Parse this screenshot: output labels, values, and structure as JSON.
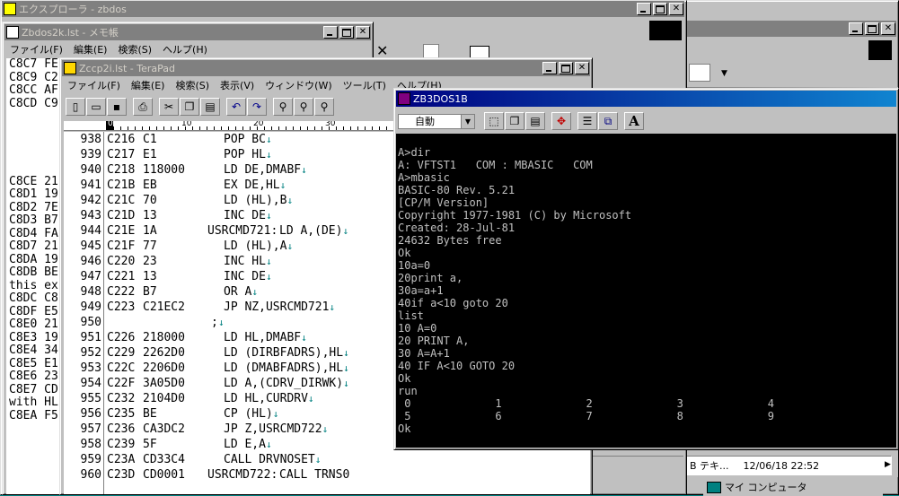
{
  "explorer": {
    "title": "エクスプローラ - zbdos"
  },
  "right_window": {
    "status_label": "B テキ...",
    "status_time": "12/06/18 22:52",
    "my_computer": "マイ コンピュータ"
  },
  "notepad": {
    "title": "Zbdos2k.lst - メモ帳",
    "menu": [
      "ファイル(F)",
      "編集(E)",
      "検索(S)",
      "ヘルプ(H)"
    ],
    "lines": [
      "C8C7 FE",
      "C8C9 C2",
      "C8CC AF",
      "C8CD C9",
      "",
      "",
      "",
      "",
      "",
      "C8CE 21",
      "C8D1 19",
      "C8D2 7E",
      "C8D3 B7",
      "C8D4 FA",
      "C8D7 21",
      "C8DA 19",
      "C8DB BE",
      "this ex",
      "C8DC C8",
      "C8DF E5",
      "C8E0 21",
      "C8E3 19",
      "C8E4 34",
      "C8E5 E1",
      "C8E6 23",
      "C8E7 CD",
      "with HL",
      "C8EA F5"
    ]
  },
  "terapad": {
    "title": "Zccp2i.lst - TeraPad",
    "menu": [
      "ファイル(F)",
      "編集(E)",
      "検索(S)",
      "表示(V)",
      "ウィンドウ(W)",
      "ツール(T)",
      "ヘルプ(H)"
    ],
    "ruler": {
      "marks": [
        "0",
        "10",
        "20",
        "30"
      ]
    },
    "lines": [
      {
        "num": "938",
        "addr": "C216",
        "hex": "C1",
        "label": "",
        "code": "POP BC",
        "lf": true
      },
      {
        "num": "939",
        "addr": "C217",
        "hex": "E1",
        "label": "",
        "code": "POP HL",
        "lf": true
      },
      {
        "num": "940",
        "addr": "C218",
        "hex": "118000",
        "label": "",
        "code": "LD DE,DMABF",
        "lf": true
      },
      {
        "num": "941",
        "addr": "C21B",
        "hex": "EB",
        "label": "",
        "code": "EX DE,HL",
        "lf": true
      },
      {
        "num": "942",
        "addr": "C21C",
        "hex": "70",
        "label": "",
        "code": "LD (HL),B",
        "lf": true
      },
      {
        "num": "943",
        "addr": "C21D",
        "hex": "13",
        "label": "",
        "code": "INC DE",
        "lf": true
      },
      {
        "num": "944",
        "addr": "C21E",
        "hex": "1A",
        "label": "USRCMD721:",
        "code": "LD A,(DE)",
        "lf": true
      },
      {
        "num": "945",
        "addr": "C21F",
        "hex": "77",
        "label": "",
        "code": "LD (HL),A",
        "lf": true
      },
      {
        "num": "946",
        "addr": "C220",
        "hex": "23",
        "label": "",
        "code": "INC HL",
        "lf": true
      },
      {
        "num": "947",
        "addr": "C221",
        "hex": "13",
        "label": "",
        "code": "INC DE",
        "lf": true
      },
      {
        "num": "948",
        "addr": "C222",
        "hex": "B7",
        "label": "",
        "code": "OR A",
        "lf": true
      },
      {
        "num": "949",
        "addr": "C223",
        "hex": "C21EC2",
        "label": "",
        "code": "JP NZ,USRCMD721",
        "lf": true
      },
      {
        "num": "950",
        "addr": "",
        "hex": "",
        "label": ";",
        "code": "",
        "lf": true
      },
      {
        "num": "951",
        "addr": "C226",
        "hex": "218000",
        "label": "",
        "code": "LD HL,DMABF",
        "lf": true
      },
      {
        "num": "952",
        "addr": "C229",
        "hex": "2262D0",
        "label": "",
        "code": "LD (DIRBFADRS),HL",
        "lf": true
      },
      {
        "num": "953",
        "addr": "C22C",
        "hex": "2206D0",
        "label": "",
        "code": "LD (DMABFADRS),HL",
        "lf": true
      },
      {
        "num": "954",
        "addr": "C22F",
        "hex": "3A05D0",
        "label": "",
        "code": "LD A,(CDRV_DIRWK)",
        "lf": true
      },
      {
        "num": "955",
        "addr": "C232",
        "hex": "2104D0",
        "label": "",
        "code": "LD HL,CURDRV",
        "lf": true
      },
      {
        "num": "956",
        "addr": "C235",
        "hex": "BE",
        "label": "",
        "code": "CP (HL)",
        "lf": true
      },
      {
        "num": "957",
        "addr": "C236",
        "hex": "CA3DC2",
        "label": "",
        "code": "JP Z,USRCMD722",
        "lf": true
      },
      {
        "num": "958",
        "addr": "C239",
        "hex": "5F",
        "label": "",
        "code": "LD E,A",
        "lf": true
      },
      {
        "num": "959",
        "addr": "C23A",
        "hex": "CD33C4",
        "label": "",
        "code": "CALL DRVNOSET",
        "lf": true
      },
      {
        "num": "960",
        "addr": "C23D",
        "hex": "CD0001",
        "label": "USRCMD722:",
        "code": "CALL TRNS0",
        "lf": false
      }
    ]
  },
  "dos": {
    "title": "ZB3DOS1B",
    "font_select": "自動",
    "lines": [
      "A>dir",
      "A: VFTST1   COM : MBASIC   COM",
      "A>mbasic",
      "BASIC-80 Rev. 5.21",
      "[CP/M Version]",
      "Copyright 1977-1981 (C) by Microsoft",
      "Created: 28-Jul-81",
      "24632 Bytes free",
      "Ok",
      "10a=0",
      "20print a,",
      "30a=a+1",
      "40if a<10 goto 20",
      "list",
      "10 A=0",
      "20 PRINT A,",
      "30 A=A+1",
      "40 IF A<10 GOTO 20",
      "Ok",
      "run",
      " 0             1             2             3             4",
      " 5             6             7             8             9",
      "Ok"
    ]
  }
}
